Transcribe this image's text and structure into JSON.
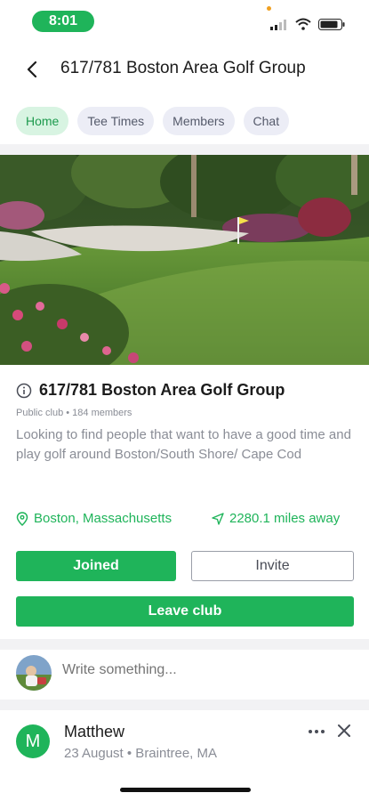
{
  "status_bar": {
    "time": "8:01",
    "icons": [
      "signal-icon",
      "wifi-icon",
      "battery-icon"
    ]
  },
  "header": {
    "back_icon": "back-arrow-icon",
    "title": "617/781 Boston Area Golf Group"
  },
  "tabs": [
    {
      "label": "Home",
      "active": true
    },
    {
      "label": "Tee Times",
      "active": false
    },
    {
      "label": "Members",
      "active": false
    },
    {
      "label": "Chat",
      "active": false
    }
  ],
  "club": {
    "info_icon": "info-icon",
    "name": "617/781 Boston Area Golf Group",
    "meta": "Public club • 184 members",
    "description": "Looking to find people that want to have a good time and play golf around Boston/South Shore/ Cape Cod",
    "location_icon": "location-pin-icon",
    "location": "Boston, Massachusetts",
    "distance_icon": "navigation-arrow-icon",
    "distance": "2280.1 miles away"
  },
  "actions": {
    "joined_label": "Joined",
    "invite_label": "Invite",
    "leave_label": "Leave club"
  },
  "compose": {
    "placeholder": "Write something..."
  },
  "post": {
    "avatar_initial": "M",
    "author": "Matthew",
    "meta": "23 August • Braintree, MA",
    "more_icon": "more-horizontal-icon",
    "close_icon": "close-icon"
  },
  "colors": {
    "accent": "#1fb45a",
    "tab_active_bg": "#d8f4e2",
    "tab_bg": "#ecedf6",
    "muted_text": "#8a8d96"
  }
}
